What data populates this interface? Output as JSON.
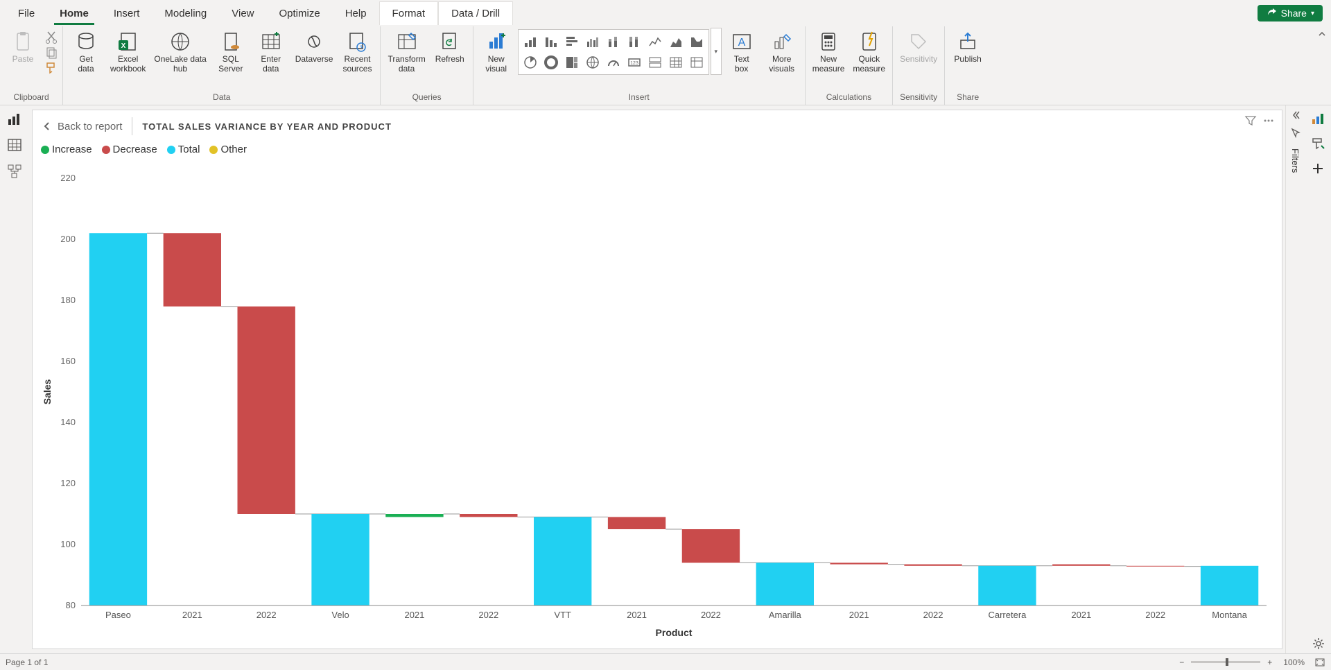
{
  "menu": {
    "tabs": [
      "File",
      "Home",
      "Insert",
      "Modeling",
      "View",
      "Optimize",
      "Help",
      "Format",
      "Data / Drill"
    ],
    "active": "Home",
    "contextual": [
      "Format",
      "Data / Drill"
    ],
    "share": "Share"
  },
  "ribbon": {
    "clipboard": {
      "paste": "Paste",
      "group": "Clipboard"
    },
    "data": {
      "get_data": "Get\ndata",
      "excel": "Excel\nworkbook",
      "onelake": "OneLake data\nhub",
      "sql": "SQL\nServer",
      "enter": "Enter\ndata",
      "dataverse": "Dataverse",
      "recent": "Recent\nsources",
      "group": "Data"
    },
    "queries": {
      "transform": "Transform\ndata",
      "refresh": "Refresh",
      "group": "Queries"
    },
    "insert": {
      "new_visual": "New\nvisual",
      "text_box": "Text\nbox",
      "more_visuals": "More\nvisuals",
      "group": "Insert"
    },
    "calculations": {
      "new_measure": "New\nmeasure",
      "quick_measure": "Quick\nmeasure",
      "group": "Calculations"
    },
    "sensitivity": {
      "label": "Sensitivity",
      "group": "Sensitivity"
    },
    "share": {
      "publish": "Publish",
      "group": "Share"
    }
  },
  "visual": {
    "back": "Back to report",
    "title": "TOTAL SALES VARIANCE BY YEAR AND PRODUCT",
    "legend": {
      "increase": "Increase",
      "decrease": "Decrease",
      "total": "Total",
      "other": "Other"
    },
    "ylabel": "Sales",
    "xlabel": "Product"
  },
  "filters_label": "Filters",
  "status": {
    "page": "Page 1 of 1",
    "zoom": "100%"
  },
  "chart_data": {
    "type": "waterfall",
    "ylabel": "Sales",
    "xlabel": "Product",
    "ylim": [
      80,
      220
    ],
    "yticks": [
      80,
      100,
      120,
      140,
      160,
      180,
      200,
      220
    ],
    "colors": {
      "increase": "#1aaf54",
      "decrease": "#c94b4b",
      "total": "#21d0f2",
      "other": "#e2c227"
    },
    "categories": [
      "Paseo",
      "2021",
      "2022",
      "Velo",
      "2021",
      "2022",
      "VTT",
      "2021",
      "2022",
      "Amarilla",
      "2021",
      "2022",
      "Carretera",
      "2021",
      "2022",
      "Montana"
    ],
    "bars": [
      {
        "label": "Paseo",
        "kind": "total",
        "start": 80,
        "end": 202
      },
      {
        "label": "2021",
        "kind": "decrease",
        "start": 202,
        "end": 178
      },
      {
        "label": "2022",
        "kind": "decrease",
        "start": 178,
        "end": 110
      },
      {
        "label": "Velo",
        "kind": "total",
        "start": 80,
        "end": 110
      },
      {
        "label": "2021",
        "kind": "increase",
        "start": 109,
        "end": 110
      },
      {
        "label": "2022",
        "kind": "decrease",
        "start": 110,
        "end": 109
      },
      {
        "label": "VTT",
        "kind": "total",
        "start": 80,
        "end": 109
      },
      {
        "label": "2021",
        "kind": "decrease",
        "start": 109,
        "end": 105
      },
      {
        "label": "2022",
        "kind": "decrease",
        "start": 105,
        "end": 94
      },
      {
        "label": "Amarilla",
        "kind": "total",
        "start": 80,
        "end": 94
      },
      {
        "label": "2021",
        "kind": "decrease",
        "start": 94,
        "end": 93.5
      },
      {
        "label": "2022",
        "kind": "decrease",
        "start": 93.5,
        "end": 93
      },
      {
        "label": "Carretera",
        "kind": "total",
        "start": 80,
        "end": 93
      },
      {
        "label": "2021",
        "kind": "decrease",
        "start": 93.5,
        "end": 93
      },
      {
        "label": "2022",
        "kind": "decrease",
        "start": 93,
        "end": 92.8
      },
      {
        "label": "Montana",
        "kind": "total",
        "start": 80,
        "end": 93
      }
    ]
  }
}
